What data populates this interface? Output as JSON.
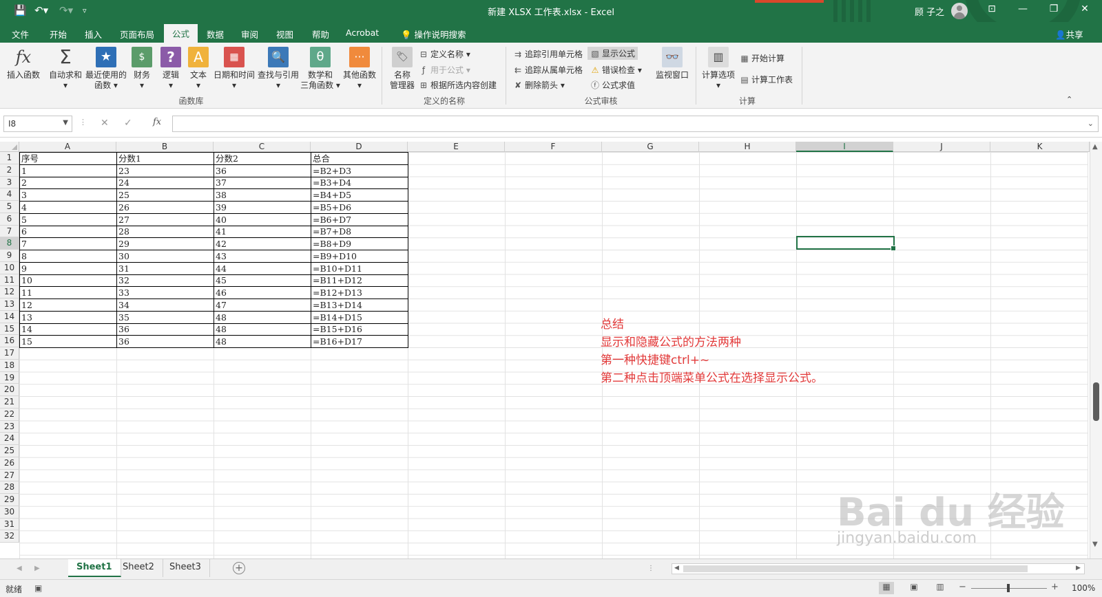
{
  "window": {
    "title": "新建 XLSX 工作表.xlsx  -  Excel",
    "user": "顾 子之",
    "accent": "#217346"
  },
  "quick_access": [
    "save-icon",
    "undo-icon",
    "redo-icon",
    "customize-icon"
  ],
  "tabs": [
    "文件",
    "开始",
    "插入",
    "页面布局",
    "公式",
    "数据",
    "审阅",
    "视图",
    "帮助",
    "Acrobat"
  ],
  "active_tab": "公式",
  "tell_me": "操作说明搜索",
  "share": "共享",
  "ribbon": {
    "function_library": {
      "label": "函数库",
      "insert_function": "插入函数",
      "autosum": "自动求和",
      "recent_1": "最近使用的",
      "recent_2": "函数",
      "financial": "财务",
      "logical": "逻辑",
      "text": "文本",
      "datetime": "日期和时间",
      "lookup": "查找与引用",
      "math_1": "数学和",
      "math_2": "三角函数",
      "more": "其他函数"
    },
    "defined_names": {
      "label": "定义的名称",
      "manager_1": "名称",
      "manager_2": "管理器",
      "define_name": "定义名称",
      "use_in_formula": "用于公式",
      "create_from_selection": "根据所选内容创建"
    },
    "auditing": {
      "label": "公式审核",
      "trace_precedents": "追踪引用单元格",
      "trace_dependents": "追踪从属单元格",
      "remove_arrows": "删除箭头",
      "show_formulas": "显示公式",
      "error_checking": "错误检查",
      "evaluate_formula": "公式求值",
      "watch_window": "监视窗口"
    },
    "calculation": {
      "label": "计算",
      "options": "计算选项",
      "calc_now": "开始计算",
      "calc_sheet": "计算工作表"
    }
  },
  "formula_bar": {
    "name_box": "I8",
    "formula": "",
    "fx": "fx"
  },
  "columns": [
    "A",
    "B",
    "C",
    "D",
    "E",
    "F",
    "G",
    "H",
    "I",
    "J",
    "K"
  ],
  "selected_column": "I",
  "rows": [
    "1",
    "2",
    "3",
    "4",
    "5",
    "6",
    "7",
    "8",
    "9",
    "10",
    "11",
    "12",
    "13",
    "14",
    "15",
    "16",
    "17",
    "18",
    "19",
    "20",
    "21",
    "22",
    "23",
    "24",
    "25",
    "26",
    "27",
    "28",
    "29",
    "30",
    "31",
    "32"
  ],
  "selected_row": "8",
  "table": [
    [
      "序号",
      "分数1",
      "分数2",
      "总合"
    ],
    [
      "1",
      "23",
      "36",
      "=B2+D3"
    ],
    [
      "2",
      "24",
      "37",
      "=B3+D4"
    ],
    [
      "3",
      "25",
      "38",
      "=B4+D5"
    ],
    [
      "4",
      "26",
      "39",
      "=B5+D6"
    ],
    [
      "5",
      "27",
      "40",
      "=B6+D7"
    ],
    [
      "6",
      "28",
      "41",
      "=B7+D8"
    ],
    [
      "7",
      "29",
      "42",
      "=B8+D9"
    ],
    [
      "8",
      "30",
      "43",
      "=B9+D10"
    ],
    [
      "9",
      "31",
      "44",
      "=B10+D11"
    ],
    [
      "10",
      "32",
      "45",
      "=B11+D12"
    ],
    [
      "11",
      "33",
      "46",
      "=B12+D13"
    ],
    [
      "12",
      "34",
      "47",
      "=B13+D14"
    ],
    [
      "13",
      "35",
      "48",
      "=B14+D15"
    ],
    [
      "14",
      "36",
      "48",
      "=B15+D16"
    ],
    [
      "15",
      "36",
      "48",
      "=B16+D17"
    ]
  ],
  "note": {
    "color": "#e23a3a",
    "lines": [
      "总结",
      "显示和隐藏公式的方法两种",
      "第一种快捷键ctrl+~",
      "第二种点击顶端菜单公式在选择显示公式。"
    ]
  },
  "sheets": [
    "Sheet1",
    "Sheet2",
    "Sheet3"
  ],
  "active_sheet": "Sheet1",
  "status": {
    "ready": "就绪",
    "zoom": "100%"
  },
  "watermark": {
    "logo_text": "Bai du 经验",
    "url": "jingyan.baidu.com"
  }
}
